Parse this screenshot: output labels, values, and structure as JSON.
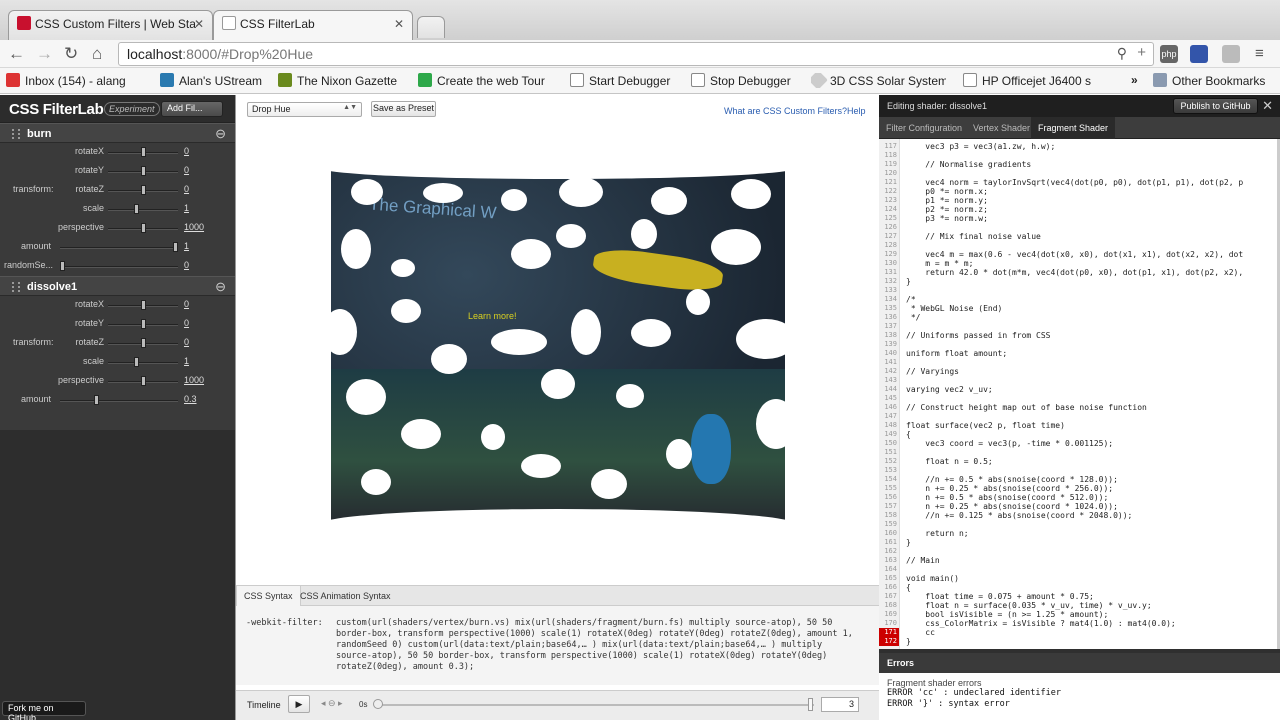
{
  "browser": {
    "tabs": [
      {
        "label": "CSS Custom Filters | Web Sta",
        "icon": "adobe-icon"
      },
      {
        "label": "CSS FilterLab",
        "icon": "page-icon"
      }
    ],
    "url_host": "localhost",
    "url_path": ":8000/#Drop%20Hue",
    "bookmarks": [
      {
        "label": "Inbox (154) - alang",
        "icon": "gmail-icon"
      },
      {
        "label": "Alan's UStream",
        "icon": "ustream-icon"
      },
      {
        "label": "The Nixon Gazette",
        "icon": "nixon-icon"
      },
      {
        "label": "Create the web Tour",
        "icon": "grid-icon"
      },
      {
        "label": "Start Debugger",
        "icon": "page-icon"
      },
      {
        "label": "Stop Debugger",
        "icon": "page-icon"
      },
      {
        "label": "3D CSS Solar System",
        "icon": "cube-icon"
      },
      {
        "label": "HP Officejet J6400 s",
        "icon": "page-icon"
      }
    ],
    "other_bookmarks": "Other Bookmarks"
  },
  "left": {
    "logo": "CSS FilterLab",
    "badge": "Experiment",
    "add_filter": "Add Fil...",
    "filters": [
      {
        "name": "burn",
        "params": [
          {
            "label": "rotateX",
            "value": "0",
            "level": 0.5
          },
          {
            "label": "rotateY",
            "value": "0",
            "level": 0.5
          },
          {
            "label": "rotateZ",
            "value": "0",
            "level": 0.5,
            "group": "transform:"
          },
          {
            "label": "scale",
            "value": "1",
            "level": 0.4
          },
          {
            "label": "perspective",
            "value": "1000",
            "level": 0.5
          },
          {
            "label": "amount",
            "value": "1",
            "level": 1.0
          },
          {
            "label": "randomSe...",
            "value": "0",
            "level": 0.0
          }
        ]
      },
      {
        "name": "dissolve1",
        "params": [
          {
            "label": "rotateX",
            "value": "0",
            "level": 0.5
          },
          {
            "label": "rotateY",
            "value": "0",
            "level": 0.5
          },
          {
            "label": "rotateZ",
            "value": "0",
            "level": 0.5,
            "group": "transform:"
          },
          {
            "label": "scale",
            "value": "1",
            "level": 0.4
          },
          {
            "label": "perspective",
            "value": "1000",
            "level": 0.5
          },
          {
            "label": "amount",
            "value": "0.3",
            "level": 0.3
          }
        ]
      }
    ],
    "fork": "Fork me on GitHub"
  },
  "center": {
    "preset_select": "Drop Hue",
    "save_preset": "Save as Preset",
    "link_what": "What are CSS Custom Filters?",
    "link_help": "Help",
    "canvas_heading": "The Graphical W",
    "canvas_learn": "Learn more!",
    "css_tabs": [
      "CSS Syntax",
      "CSS Animation Syntax"
    ],
    "css_property": "-webkit-filter:",
    "css_value": "custom(url(shaders/vertex/burn.vs) mix(url(shaders/fragment/burn.fs) multiply source-atop), 50 50 border-box, transform perspective(1000) scale(1) rotateX(0deg) rotateY(0deg) rotateZ(0deg), amount 1, randomSeed 0) custom(url(data:text/plain;base64,… ) mix(url(data:text/plain;base64,… ) multiply source-atop), 50 50 border-box, transform perspective(1000) scale(1) rotateX(0deg) rotateY(0deg) rotateZ(0deg), amount 0.3);",
    "timeline_label": "Timeline",
    "timeline_seconds": "0s",
    "timeline_value": "3"
  },
  "right": {
    "title": "Editing shader: dissolve1",
    "publish": "Publish to GitHub",
    "tabs": [
      "Filter Configuration",
      "Vertex Shader",
      "Fragment Shader"
    ],
    "code": [
      {
        "n": "117",
        "t": "    vec3 p3 = vec3(a1.zw, h.w);"
      },
      {
        "n": "118",
        "t": ""
      },
      {
        "n": "119",
        "t": "    // Normalise gradients"
      },
      {
        "n": "120",
        "t": ""
      },
      {
        "n": "121",
        "t": "    vec4 norm = taylorInvSqrt(vec4(dot(p0, p0), dot(p1, p1), dot(p2, p"
      },
      {
        "n": "122",
        "t": "    p0 *= norm.x;"
      },
      {
        "n": "123",
        "t": "    p1 *= norm.y;"
      },
      {
        "n": "124",
        "t": "    p2 *= norm.z;"
      },
      {
        "n": "125",
        "t": "    p3 *= norm.w;"
      },
      {
        "n": "126",
        "t": ""
      },
      {
        "n": "127",
        "t": "    // Mix final noise value"
      },
      {
        "n": "128",
        "t": ""
      },
      {
        "n": "129",
        "t": "    vec4 m = max(0.6 - vec4(dot(x0, x0), dot(x1, x1), dot(x2, x2), dot"
      },
      {
        "n": "130",
        "t": "    m = m * m;"
      },
      {
        "n": "131",
        "t": "    return 42.0 * dot(m*m, vec4(dot(p0, x0), dot(p1, x1), dot(p2, x2),"
      },
      {
        "n": "132",
        "t": "}"
      },
      {
        "n": "133",
        "t": ""
      },
      {
        "n": "134",
        "t": "/*"
      },
      {
        "n": "135",
        "t": " * WebGL Noise (End)"
      },
      {
        "n": "136",
        "t": " */"
      },
      {
        "n": "137",
        "t": ""
      },
      {
        "n": "138",
        "t": "// Uniforms passed in from CSS"
      },
      {
        "n": "139",
        "t": ""
      },
      {
        "n": "140",
        "t": "uniform float amount;"
      },
      {
        "n": "141",
        "t": ""
      },
      {
        "n": "142",
        "t": "// Varyings"
      },
      {
        "n": "143",
        "t": ""
      },
      {
        "n": "144",
        "t": "varying vec2 v_uv;"
      },
      {
        "n": "145",
        "t": ""
      },
      {
        "n": "146",
        "t": "// Construct height map out of base noise function"
      },
      {
        "n": "147",
        "t": ""
      },
      {
        "n": "148",
        "t": "float surface(vec2 p, float time)"
      },
      {
        "n": "149",
        "t": "{"
      },
      {
        "n": "150",
        "t": "    vec3 coord = vec3(p, -time * 0.001125);"
      },
      {
        "n": "151",
        "t": ""
      },
      {
        "n": "152",
        "t": "    float n = 0.5;"
      },
      {
        "n": "153",
        "t": ""
      },
      {
        "n": "154",
        "t": "    //n += 0.5 * abs(snoise(coord * 128.0));"
      },
      {
        "n": "155",
        "t": "    n += 0.25 * abs(snoise(coord * 256.0));"
      },
      {
        "n": "156",
        "t": "    n += 0.5 * abs(snoise(coord * 512.0));"
      },
      {
        "n": "157",
        "t": "    n += 0.25 * abs(snoise(coord * 1024.0));"
      },
      {
        "n": "158",
        "t": "    //n += 0.125 * abs(snoise(coord * 2048.0));"
      },
      {
        "n": "159",
        "t": ""
      },
      {
        "n": "160",
        "t": "    return n;"
      },
      {
        "n": "161",
        "t": "}"
      },
      {
        "n": "162",
        "t": ""
      },
      {
        "n": "163",
        "t": "// Main"
      },
      {
        "n": "164",
        "t": ""
      },
      {
        "n": "165",
        "t": "void main()"
      },
      {
        "n": "166",
        "t": "{"
      },
      {
        "n": "167",
        "t": "    float time = 0.075 + amount * 0.75;"
      },
      {
        "n": "168",
        "t": "    float n = surface(0.035 * v_uv, time) * v_uv.y;"
      },
      {
        "n": "169",
        "t": "    bool isVisible = (n >= 1.25 * amount);"
      },
      {
        "n": "170",
        "t": "    css_ColorMatrix = isVisible ? mat4(1.0) : mat4(0.0);"
      },
      {
        "n": "171",
        "t": "    cc",
        "err": true
      },
      {
        "n": "172",
        "t": "}",
        "err": true
      }
    ],
    "errors_title": "Errors",
    "errors_sub": "Fragment shader errors",
    "errors": [
      "ERROR 'cc' : undeclared identifier",
      "ERROR '}' : syntax error"
    ]
  }
}
